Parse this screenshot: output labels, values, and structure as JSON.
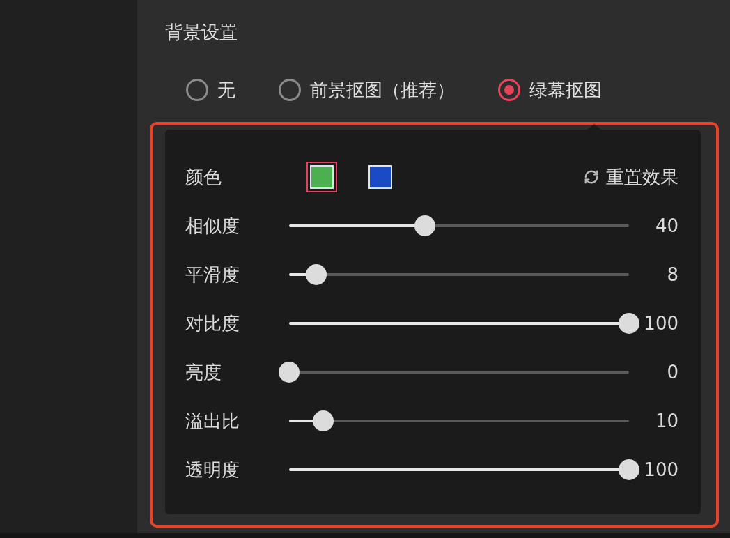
{
  "section_title": "背景设置",
  "background_modes": [
    {
      "label": "无",
      "selected": false
    },
    {
      "label": "前景抠图（推荐）",
      "selected": false
    },
    {
      "label": "绿幕抠图",
      "selected": true
    }
  ],
  "color_row": {
    "label": "颜色",
    "swatches": [
      {
        "color": "#4caf50",
        "selected": true
      },
      {
        "color": "#1a4bc4",
        "selected": false
      }
    ],
    "reset_label": "重置效果"
  },
  "sliders": [
    {
      "label": "相似度",
      "level": 0.4,
      "reading": "40"
    },
    {
      "label": "平滑度",
      "level": 0.08,
      "reading": "8"
    },
    {
      "label": "对比度",
      "level": 1,
      "reading": "100"
    },
    {
      "label": "亮度",
      "level": 0,
      "reading": "0"
    },
    {
      "label": "溢出比",
      "level": 0.1,
      "reading": "10"
    },
    {
      "label": "透明度",
      "level": 1,
      "reading": "100"
    }
  ]
}
